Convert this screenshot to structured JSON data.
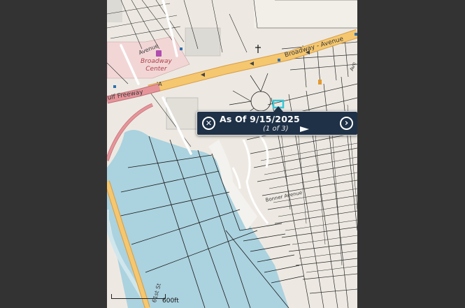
{
  "popup": {
    "title": "As Of 9/15/2025",
    "count": "(1 of 3)",
    "close_icon": "close-circle-icon",
    "next_icon": "chevron-right-circle-icon",
    "play_icon": "play-triangle-icon"
  },
  "map": {
    "labels": {
      "broadway_center": "Broadway\nCenter",
      "broadway_avenue": "Broadway - Avenue",
      "gulf_freeway": "ulf Freeway",
      "route_shield": "'A",
      "avenue_top": "Avenue",
      "st_19": "61st St",
      "bonner": "Bonner Avenue",
      "avenue_side": "Ave"
    },
    "scale_label": "600ft",
    "colors": {
      "land": "#ede9e2",
      "water": "#abd2df",
      "highway": "#f5c76f",
      "highway_edge": "#d89c45",
      "freeway": "#e6949a",
      "popup_bg": "#1f3147"
    }
  }
}
